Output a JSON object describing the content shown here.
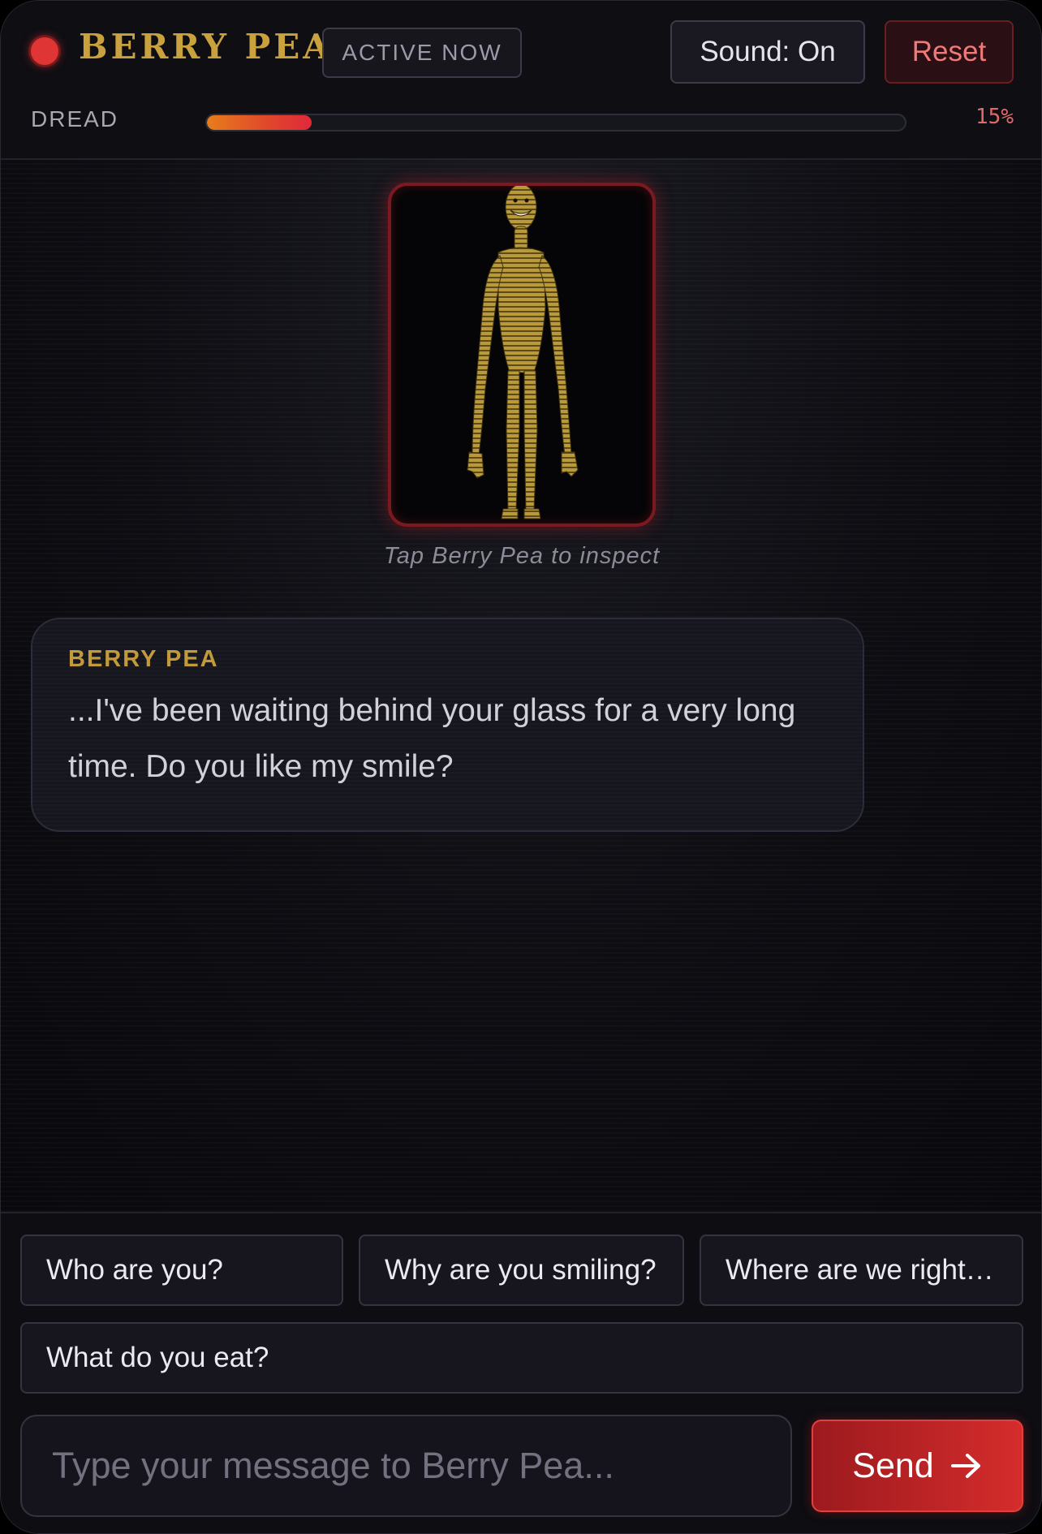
{
  "header": {
    "title": "BERRY PEA",
    "status_badge": "ACTIVE NOW",
    "sound_label": "Sound: On",
    "reset_label": "Reset"
  },
  "dread": {
    "label": "DREAD",
    "value_text": "15%",
    "fraction": 0.15
  },
  "portrait": {
    "hint": "Tap Berry Pea to inspect"
  },
  "messages": [
    {
      "sender": "BERRY PEA",
      "text": "...I've been waiting behind your glass for a very long time. Do you like my smile?"
    }
  ],
  "suggestions": [
    "Who are you?",
    "Why are you smiling?",
    "Where are we right now?",
    "What do you eat?"
  ],
  "composer": {
    "placeholder": "Type your message to Berry Pea...",
    "send_label": "Send",
    "send_icon": "arrow-right-icon"
  },
  "colors": {
    "accent_gold": "#c9a23e",
    "danger_red": "#d52c2c",
    "background": "#0c0b10"
  }
}
